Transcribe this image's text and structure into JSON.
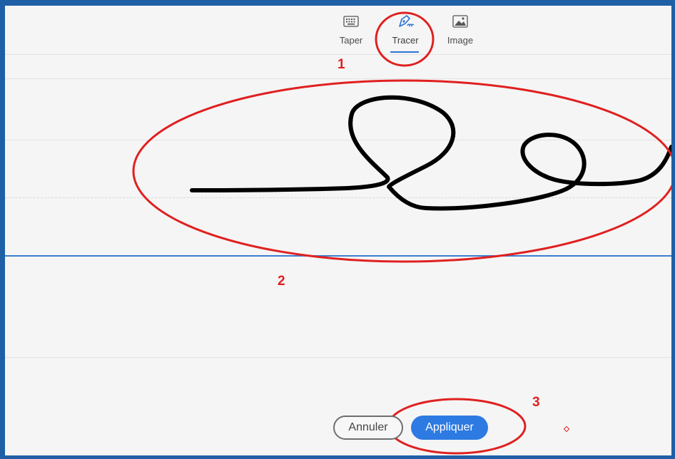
{
  "tabs": [
    {
      "label": "Taper",
      "icon": "keyboard-icon",
      "active": false
    },
    {
      "label": "Tracer",
      "icon": "pen-icon",
      "active": true
    },
    {
      "label": "Image",
      "icon": "image-icon",
      "active": false
    }
  ],
  "buttons": {
    "cancel_label": "Annuler",
    "apply_label": "Appliquer"
  },
  "annotations": {
    "step1": "1",
    "step2": "2",
    "step3": "3"
  },
  "colors": {
    "accent": "#2d7ae3",
    "annotation": "#e02020",
    "ink": "#000000",
    "frame": "#1f5fa6"
  }
}
